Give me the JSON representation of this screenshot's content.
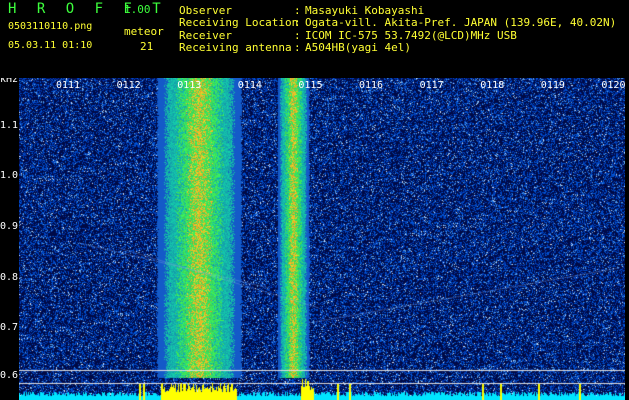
{
  "header": {
    "app_title": "H R O F F T",
    "app_version": "1.00",
    "file_name": "0503110110.png",
    "date_time": "05.03.11 01:10",
    "meteor_label": "meteor",
    "meteor_count": "21",
    "info": [
      {
        "label": "Observer",
        "value": "Masayuki Kobayashi"
      },
      {
        "label": "Receiving Location",
        "value": "Ogata-vill. Akita-Pref. JAPAN (139.96E, 40.02N)"
      },
      {
        "label": "Receiver",
        "value": "ICOM IC-575 53.7492(@LCD)MHz USB"
      },
      {
        "label": "Receiving antenna",
        "value": "A504HB(yagi 4el)"
      }
    ],
    "separator": ":"
  },
  "axes": {
    "y_unit": "kHz",
    "y_ticks": [
      "1.1",
      "1.0",
      "0.9",
      "0.8",
      "0.7",
      "0.6"
    ],
    "x_ticks": [
      "0111",
      "0112",
      "0113",
      "0114",
      "0115",
      "0116",
      "0117",
      "0118",
      "0119",
      "0120"
    ]
  },
  "colors": {
    "background": "#000000",
    "header_text": "#3dff3d",
    "meta_text": "#ffff33",
    "axis_text": "#ffffff",
    "noise_floor": "#00e5ff",
    "meteor_bar": "#ffff00"
  }
}
